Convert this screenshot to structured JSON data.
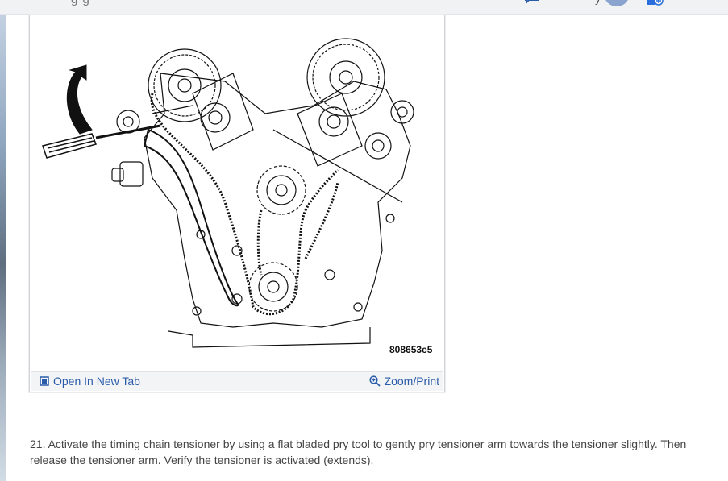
{
  "header": {
    "partial_title": "g g",
    "partial_y": "y",
    "icons": [
      "chat-icon",
      "avatar",
      "tabs-icon",
      "chevron-down-icon"
    ]
  },
  "figure": {
    "reference_code": "808653c5",
    "open_in_new_tab_label": "Open In New Tab",
    "zoom_print_label": "Zoom/Print",
    "open_icon": "open-in-new-tab-icon",
    "zoom_icon": "zoom-icon"
  },
  "step": {
    "text": "21. Activate the timing chain tensioner by using a flat bladed pry tool to gently pry tensioner arm towards the tensioner slightly. Then release the tensioner arm. Verify the tensioner is activated (extends)."
  },
  "colors": {
    "link": "#2a5caa",
    "text": "#444444",
    "avatar": "#8aa4cf",
    "footer_bg": "#f3f4f6"
  }
}
